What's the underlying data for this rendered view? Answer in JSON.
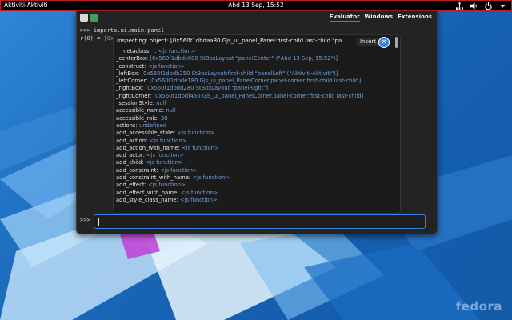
{
  "topbar": {
    "activities_label": "Aktiviti-Aktiviti",
    "clock": "Ahd 13 Sep, 15:52",
    "tray_icons": [
      "network-icon",
      "volume-icon",
      "power-icon",
      "chevron-down-icon"
    ]
  },
  "looking_glass": {
    "tabs": [
      "Evaluator",
      "Windows",
      "Extensions"
    ],
    "active_tab": "Evaluator",
    "results": [
      {
        "text": ">>> imports.ui.main.panel"
      },
      {
        "prefix": "r(0) = ",
        "value": "[0x"
      }
    ],
    "entry": {
      "prompt": ">>>",
      "value": ""
    }
  },
  "inspector": {
    "title": "Inspecting: object: [0x560f1dbdaa80 Gjs_ui_panel_Panel:first-child last-child \"panel\" (\"Ak…",
    "insert_label": "Insert",
    "close_label": "✕",
    "properties": [
      {
        "name": "__metaclass__",
        "value": "<js function>"
      },
      {
        "name": "_centerBox",
        "value": "[0x560f1dbdc000 StBoxLayout \"panelCenter\" (\"Ahd 13 Sep, 15:52\")]"
      },
      {
        "name": "_construct",
        "value": "<js function>"
      },
      {
        "name": "_leftBox",
        "value": "[0x560f1dbdb250 StBoxLayout:first-child \"panelLeft\" (\"Aktiviti-Aktiviti\")]"
      },
      {
        "name": "_leftCorner",
        "value": "[0x560f1dbde180 Gjs_ui_panel_PanelCorner.panel-corner:first-child last-child]"
      },
      {
        "name": "_rightBox",
        "value": "[0x560f1dbdd280 StBoxLayout \"panelRight\"]"
      },
      {
        "name": "_rightCorner",
        "value": "[0x560f1dbdf460 Gjs_ui_panel_PanelCorner.panel-corner:first-child last-child]"
      },
      {
        "name": "_sessionStyle",
        "value": "null"
      },
      {
        "name": "accessible_name",
        "value": "null"
      },
      {
        "name": "accessible_role",
        "value": "38"
      },
      {
        "name": "actions",
        "value": "undefined"
      },
      {
        "name": "add_accessible_state",
        "value": "<js function>"
      },
      {
        "name": "add_action",
        "value": "<js function>"
      },
      {
        "name": "add_action_with_name",
        "value": "<js function>"
      },
      {
        "name": "add_actor",
        "value": "<js function>"
      },
      {
        "name": "add_child",
        "value": "<js function>"
      },
      {
        "name": "add_constraint",
        "value": "<js function>"
      },
      {
        "name": "add_constraint_with_name",
        "value": "<js function>"
      },
      {
        "name": "add_effect",
        "value": "<js function>"
      },
      {
        "name": "add_effect_with_name",
        "value": "<js function>"
      },
      {
        "name": "add_style_class_name",
        "value": "<js function>"
      }
    ]
  },
  "wallpaper": {
    "brand": "fedora"
  },
  "colors": {
    "accent": "#3584e4",
    "value_blue": "#6d9fd8",
    "topbar_border": "#c01c28"
  }
}
